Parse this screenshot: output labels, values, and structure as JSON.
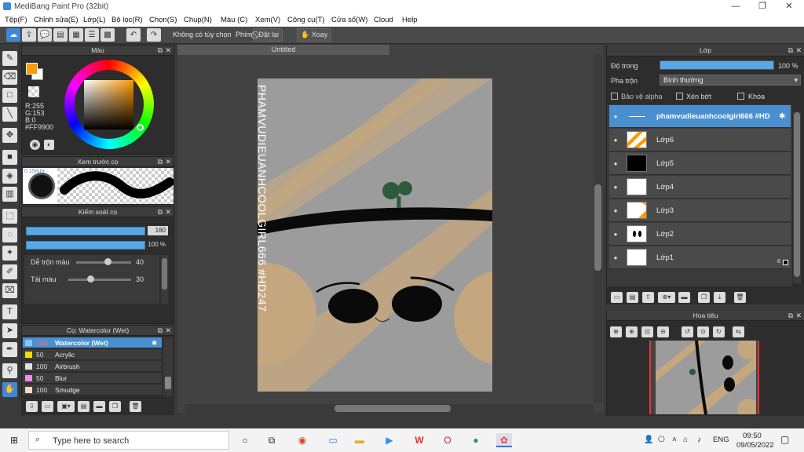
{
  "app": {
    "title": "MediBang Paint Pro (32bit)",
    "window_controls": [
      "—",
      "❐",
      "✕"
    ]
  },
  "menu": [
    "Tệp(F)",
    "Chỉnh sửa(E)",
    "Lớp(L)",
    "Bộ lọc(R)",
    "Chọn(S)",
    "Chụp(N)",
    "Màu (C)",
    "Xem(V)",
    "Công cụ(T)",
    "Cửa sổ(W)",
    "Cloud",
    "Help"
  ],
  "toolbar": {
    "no_selection": "Không có tùy chọn",
    "key_label": "Phím",
    "reset_label": "Đặt lại",
    "rotate_label": "Xoay"
  },
  "color_panel": {
    "title": "Màu",
    "r": "R:255",
    "g": "G:153",
    "b": "B:0",
    "hex": "#FF9900",
    "main_color": "#FF9900"
  },
  "brush_preview": {
    "title": "Xem trước cọ",
    "size_label": "0.15mm"
  },
  "brush_control": {
    "title": "Kiểm soát cọ",
    "size_value": "160",
    "opacity_value": "100 %",
    "blend_label": "Dễ trộn màu",
    "blend_value": "40",
    "load_label": "Tải màu",
    "load_value": "30",
    "blend_fraction": 0.4,
    "load_fraction": 0.3
  },
  "brush_list": {
    "title": "Cọ: Watercolor (Wet)",
    "items": [
      {
        "size": "160",
        "name": "Watercolor (Wet)",
        "color": "#7ec8f0"
      },
      {
        "size": "50",
        "name": "Acrylic",
        "color": "#f0e000"
      },
      {
        "size": "100",
        "name": "Airbrush",
        "color": "#e0e0e0"
      },
      {
        "size": "50",
        "name": "Blur",
        "color": "#f08cf0"
      },
      {
        "size": "100",
        "name": "Smudge",
        "color": "#f8d8c0"
      }
    ]
  },
  "document": {
    "tab": "Untitled",
    "vertical_text": "PHAMVUDIEUANHCOOLGIRL666 #HD247"
  },
  "layer_panel": {
    "title": "Lớp",
    "opacity_label": "Độ trong",
    "opacity_value": "100 %",
    "opacity_fraction": 1.0,
    "blend_label": "Pha trộn",
    "blend_value": "Bình thường",
    "protect_alpha": "Bảo vệ alpha",
    "clipping": "Xén bớt",
    "lock": "Khóa",
    "layers": [
      {
        "name": "phamvudieuanhcoolgirl666 #HD",
        "selected": true
      },
      {
        "name": "Lớp6",
        "selected": false
      },
      {
        "name": "Lớp5",
        "selected": false
      },
      {
        "name": "Lớp4",
        "selected": false
      },
      {
        "name": "Lớp3",
        "selected": false
      },
      {
        "name": "Lớp2",
        "selected": false
      },
      {
        "name": "Lớp1",
        "selected": false
      }
    ],
    "layer1_badge": "8"
  },
  "navigator": {
    "title": "Hoa tiêu"
  },
  "taskbar": {
    "search_placeholder": "Type here to search",
    "lang": "ENG",
    "time": "09:50",
    "date": "09/05/2022"
  }
}
